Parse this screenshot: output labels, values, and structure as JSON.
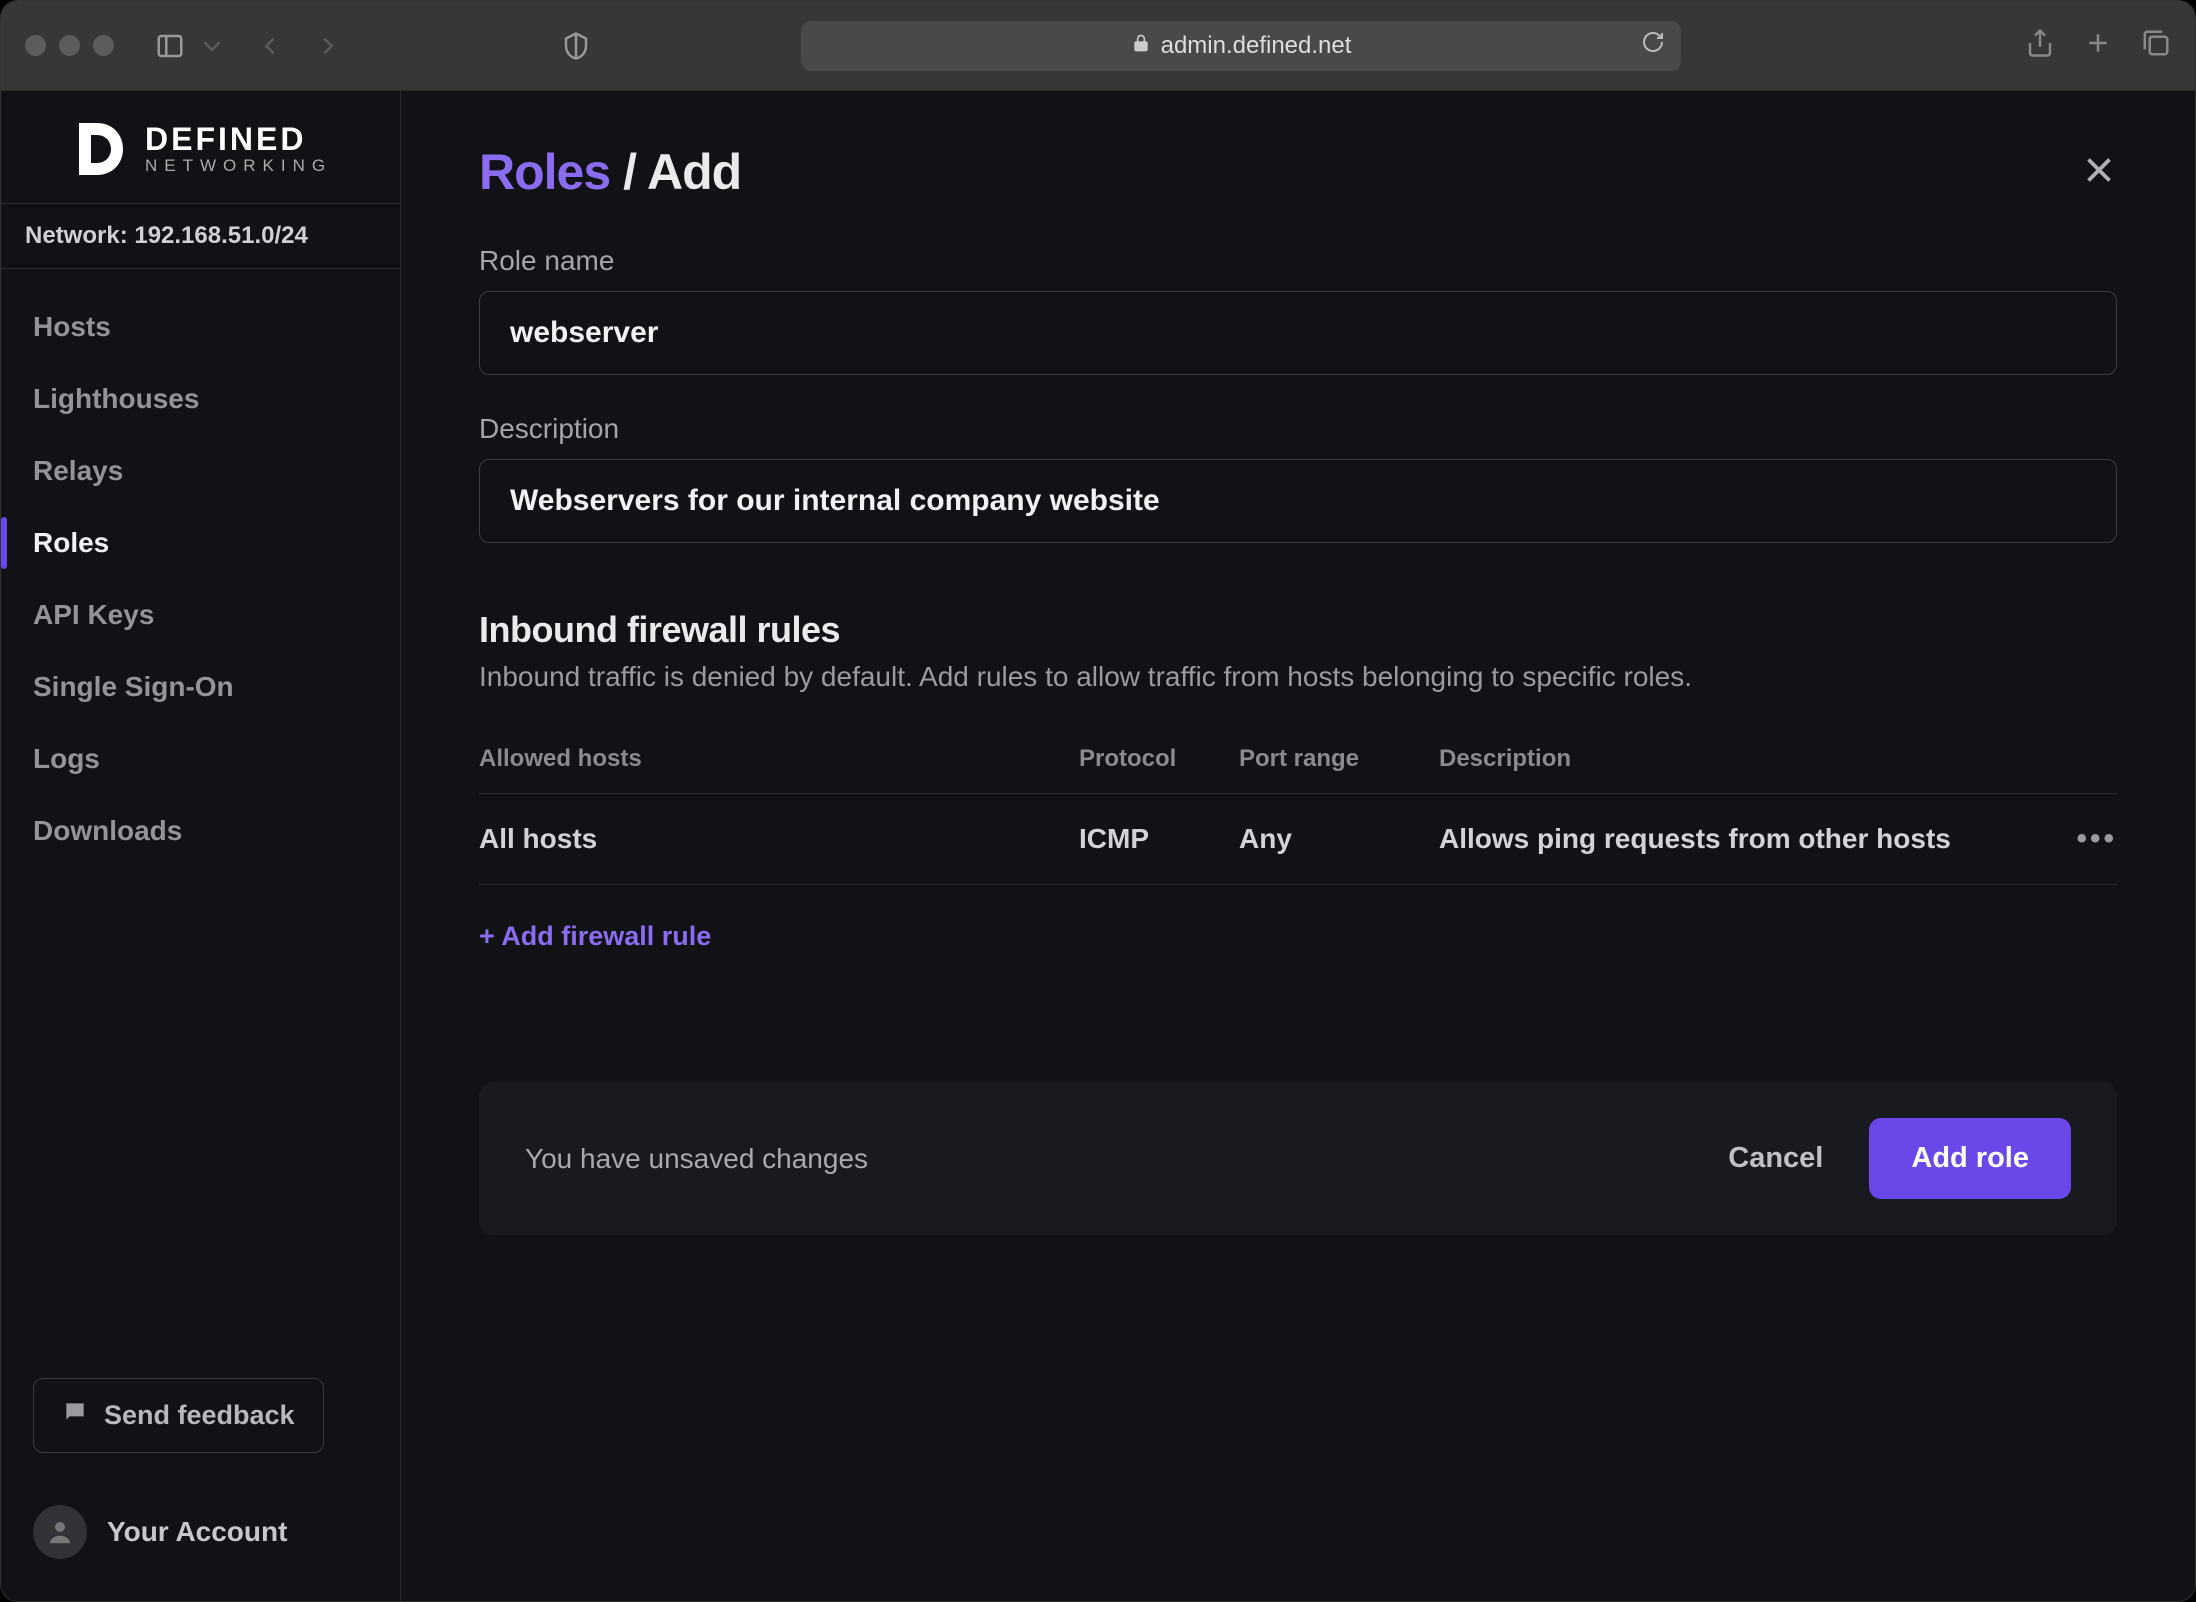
{
  "browser": {
    "url": "admin.defined.net"
  },
  "brand": {
    "name": "DEFINED",
    "subtitle": "NETWORKING"
  },
  "network_label": "Network: 192.168.51.0/24",
  "nav": {
    "hosts": "Hosts",
    "lighthouses": "Lighthouses",
    "relays": "Relays",
    "roles": "Roles",
    "api_keys": "API Keys",
    "sso": "Single Sign-On",
    "logs": "Logs",
    "downloads": "Downloads"
  },
  "feedback_label": "Send feedback",
  "account_label": "Your Account",
  "page": {
    "breadcrumb_root": "Roles",
    "breadcrumb_sep": " / ",
    "breadcrumb_current": "Add"
  },
  "form": {
    "role_name_label": "Role name",
    "role_name_value": "webserver",
    "description_label": "Description",
    "description_value": "Webservers for our internal company website"
  },
  "firewall": {
    "title": "Inbound firewall rules",
    "subtitle": "Inbound traffic is denied by default. Add rules to allow traffic from hosts belonging to specific roles.",
    "columns": {
      "allowed_hosts": "Allowed hosts",
      "protocol": "Protocol",
      "port_range": "Port range",
      "description": "Description"
    },
    "rows": [
      {
        "allowed_hosts": "All hosts",
        "protocol": "ICMP",
        "port_range": "Any",
        "description": "Allows ping requests from other hosts"
      }
    ],
    "add_rule_label": "+ Add firewall rule"
  },
  "footer_bar": {
    "unsaved": "You have unsaved changes",
    "cancel": "Cancel",
    "submit": "Add role"
  },
  "colors": {
    "accent": "#8a6cf0",
    "primary_button": "#6a47e8"
  }
}
